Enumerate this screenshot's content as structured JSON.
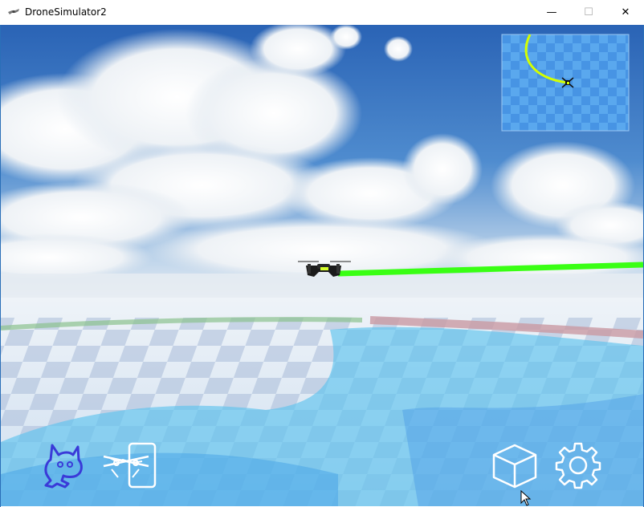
{
  "window": {
    "title": "DroneSimulator2",
    "minimize_glyph": "—",
    "maximize_glyph": "☐",
    "close_glyph": "✕"
  },
  "icons": {
    "app": "drone-icon",
    "hud_left": [
      "scratch-cat-icon",
      "drone-card-icon"
    ],
    "hud_right": [
      "cube-icon",
      "gear-icon"
    ]
  },
  "colors": {
    "flight_path": "#39ff14",
    "minimap_path": "#d4ff00",
    "sky": "#2f6fc0",
    "floor_light": "#d8e8f4",
    "floor_check": "#9db5d6",
    "water": "#6cc9f0",
    "red_line": "#c8a0a8"
  }
}
